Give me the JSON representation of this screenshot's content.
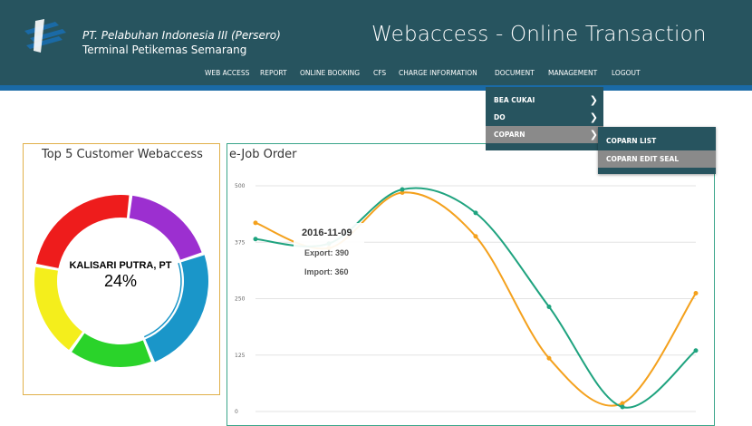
{
  "header": {
    "company_name": "PT. Pelabuhan Indonesia III (Persero)",
    "company_sub": "Terminal Petikemas Semarang",
    "app_title": "Webaccess - Online Transaction",
    "logo": "pelindo-logo-icon",
    "colors": {
      "bar": "#27545f",
      "stripe": "#1a6aa6"
    }
  },
  "nav": {
    "items": [
      "WEB ACCESS",
      "REPORT",
      "ONLINE BOOKING",
      "CFS",
      "CHARGE INFORMATION",
      "DOCUMENT",
      "MANAGEMENT",
      "LOGOUT"
    ]
  },
  "document_menu": {
    "items": [
      {
        "label": "BEA CUKAI",
        "icon": "chevron-right-icon"
      },
      {
        "label": "DO",
        "icon": "chevron-right-icon"
      },
      {
        "label": "COPARN",
        "icon": "chevron-right-icon",
        "active": true
      }
    ]
  },
  "coparn_submenu": {
    "items": [
      {
        "label": "COPARN LIST"
      },
      {
        "label": "COPARN EDIT SEAL",
        "active": true
      }
    ]
  },
  "top_customers": {
    "title": "Top 5 Customer Webaccess",
    "highlight_label": "KALISARI PUTRA, PT",
    "highlight_pct": "24%",
    "chart_data": {
      "type": "pie",
      "slices": [
        {
          "color": "#9c2fd0",
          "value": 18
        },
        {
          "color": "#1a96c9",
          "value": 24,
          "highlighted": true
        },
        {
          "color": "#2ad32a",
          "value": 16
        },
        {
          "color": "#f4ee1c",
          "value": 18
        },
        {
          "color": "#ee1c1c",
          "value": 24
        }
      ]
    }
  },
  "job_order": {
    "title": "e-Job Order",
    "tooltip": {
      "date": "2016-11-09",
      "export": "Export: 390",
      "import": "Import: 360"
    },
    "chart_data": {
      "type": "line",
      "y_ticks": [
        "500",
        "375",
        "250",
        "125",
        "0"
      ],
      "ylim": [
        0,
        500
      ],
      "series": [
        {
          "color": "#f4a11d",
          "values": [
            418,
            362,
            485,
            388,
            118,
            18,
            262
          ]
        },
        {
          "color": "#1fa37f",
          "values": [
            382,
            372,
            492,
            440,
            232,
            10,
            135
          ]
        }
      ]
    }
  }
}
